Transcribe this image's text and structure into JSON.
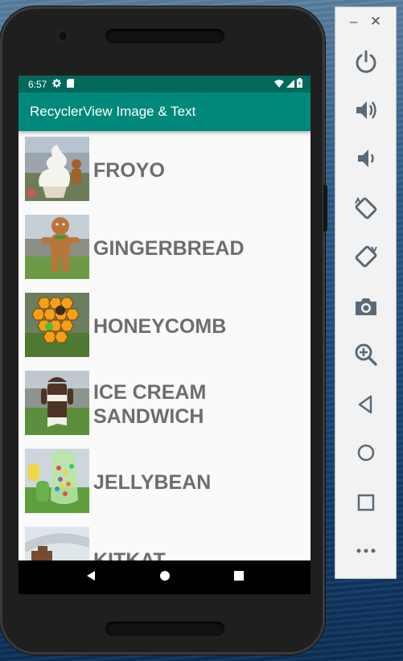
{
  "status": {
    "time": "6:57"
  },
  "app": {
    "title": "RecyclerView Image & Text"
  },
  "items": [
    {
      "label": "FROYO"
    },
    {
      "label": "GINGERBREAD"
    },
    {
      "label": "HONEYCOMB"
    },
    {
      "label": "ICE CREAM SANDWICH"
    },
    {
      "label": "JELLYBEAN"
    },
    {
      "label": "KITKAT"
    }
  ],
  "panel": {
    "buttons": [
      "power-icon",
      "volume-up-icon",
      "volume-down-icon",
      "rotate-left-icon",
      "rotate-right-icon",
      "camera-icon",
      "zoom-icon",
      "back-icon",
      "home-icon",
      "overview-icon",
      "more-icon"
    ]
  },
  "colors": {
    "statusbar": "#00695c",
    "appbar": "#00897b",
    "label": "#6d6d6d"
  }
}
